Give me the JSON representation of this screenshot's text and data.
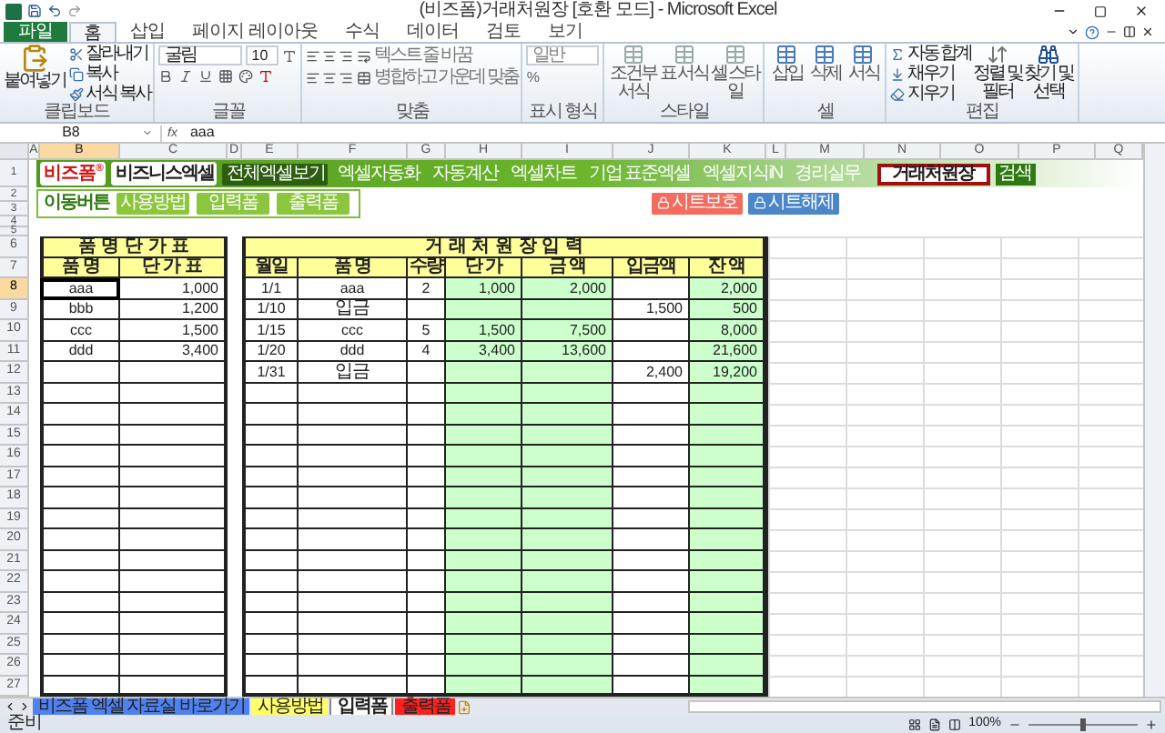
{
  "window": {
    "title": "(비즈폼)거래처원장 [호환 모드] - Microsoft Excel"
  },
  "ribbon_tabs": [
    {
      "label": "파일",
      "kind": "file",
      "selected": false
    },
    {
      "label": "홈",
      "kind": "tab",
      "selected": true
    },
    {
      "label": "삽입",
      "kind": "tab",
      "selected": false
    },
    {
      "label": "페이지 레이아웃",
      "kind": "tab",
      "selected": false
    },
    {
      "label": "수식",
      "kind": "tab",
      "selected": false
    },
    {
      "label": "데이터",
      "kind": "tab",
      "selected": false
    },
    {
      "label": "검토",
      "kind": "tab",
      "selected": false
    },
    {
      "label": "보기",
      "kind": "tab",
      "selected": false
    }
  ],
  "ribbon": {
    "groups": [
      {
        "kind": "clipboard",
        "label": "클립보드",
        "paste": "붙여넣기",
        "items": [
          "잘라내기",
          "복사",
          "서식 복사"
        ]
      },
      {
        "kind": "font",
        "label": "글꼴",
        "font": "굴림",
        "size": "10"
      },
      {
        "kind": "alignment",
        "label": "맞춤",
        "items": [
          "텍스트 줄 바꿈",
          "병합하고 가운데 맞춤"
        ]
      },
      {
        "kind": "number",
        "label": "표시 형식",
        "format": "일반",
        "symbol": "%"
      },
      {
        "kind": "styles",
        "label": "스타일",
        "items": [
          "조건부 서식",
          "표 서식",
          "셀 스타일"
        ]
      },
      {
        "kind": "cells",
        "label": "셀",
        "items": [
          "삽입",
          "삭제",
          "서식"
        ]
      },
      {
        "kind": "editing",
        "label": "편집",
        "items": [
          "자동 합계",
          "채우기",
          "지우기"
        ],
        "big": [
          "정렬 및 필터",
          "찾기 및 선택"
        ]
      }
    ]
  },
  "formula_bar": {
    "name_box": "B8",
    "function_label": "fx",
    "value": "aaa"
  },
  "column_headers": [
    {
      "label": "A",
      "selected": false
    },
    {
      "label": "B",
      "selected": true
    },
    {
      "label": "C",
      "selected": false
    },
    {
      "label": "D",
      "selected": false
    },
    {
      "label": "E",
      "selected": false
    },
    {
      "label": "F",
      "selected": false
    },
    {
      "label": "G",
      "selected": false
    },
    {
      "label": "H",
      "selected": false
    },
    {
      "label": "I",
      "selected": false
    },
    {
      "label": "J",
      "selected": false
    },
    {
      "label": "K",
      "selected": false
    },
    {
      "label": "L",
      "selected": false
    },
    {
      "label": "M",
      "selected": false
    },
    {
      "label": "N",
      "selected": false
    },
    {
      "label": "O",
      "selected": false
    },
    {
      "label": "P",
      "selected": false
    },
    {
      "label": "Q",
      "selected": false
    }
  ],
  "row_headers": [
    {
      "label": "1",
      "selected": false
    },
    {
      "label": "2",
      "selected": false
    },
    {
      "label": "3",
      "selected": false
    },
    {
      "label": "4",
      "selected": false
    },
    {
      "label": "5",
      "selected": false
    },
    {
      "label": "6",
      "selected": false
    },
    {
      "label": "7",
      "selected": false
    },
    {
      "label": "8",
      "selected": true
    },
    {
      "label": "9",
      "selected": false
    },
    {
      "label": "10",
      "selected": false
    },
    {
      "label": "11",
      "selected": false
    },
    {
      "label": "12",
      "selected": false
    },
    {
      "label": "13",
      "selected": false
    },
    {
      "label": "14",
      "selected": false
    },
    {
      "label": "15",
      "selected": false
    },
    {
      "label": "16",
      "selected": false
    },
    {
      "label": "17",
      "selected": false
    },
    {
      "label": "18",
      "selected": false
    },
    {
      "label": "19",
      "selected": false
    },
    {
      "label": "20",
      "selected": false
    },
    {
      "label": "21",
      "selected": false
    },
    {
      "label": "22",
      "selected": false
    },
    {
      "label": "23",
      "selected": false
    },
    {
      "label": "24",
      "selected": false
    },
    {
      "label": "25",
      "selected": false
    },
    {
      "label": "26",
      "selected": false
    },
    {
      "label": "27",
      "selected": false
    }
  ],
  "banner": {
    "logo": "비즈폼",
    "logo_mark": "®",
    "brand": "비즈니스엑셀",
    "nav": [
      {
        "label": "전체엑셀보기",
        "selected": true
      },
      {
        "label": "엑셀자동화",
        "selected": false
      },
      {
        "label": "자동계산",
        "selected": false
      },
      {
        "label": "엑셀차트",
        "selected": false
      },
      {
        "label": "기업 표준엑셀",
        "selected": false
      },
      {
        "label": "엑셀지식iN",
        "selected": false
      },
      {
        "label": "경리실무",
        "selected": false
      }
    ],
    "search_value": "거래처원장",
    "search_button": "검색"
  },
  "move_buttons": {
    "label": "이동버튼",
    "buttons": [
      "사용방법",
      "입력폼",
      "출력폼"
    ]
  },
  "protect_buttons": [
    {
      "label": "시트보호",
      "color": "#f26c5f"
    },
    {
      "label": "시트해제",
      "color": "#4a86c8"
    }
  ],
  "price_table": {
    "title": "품 명 단 가 표",
    "headers": [
      "품 명",
      "단 가 표"
    ],
    "rows": [
      {
        "item": "aaa",
        "price": "1,000",
        "selected": true
      },
      {
        "item": "bbb",
        "price": "1,200",
        "selected": false
      },
      {
        "item": "ccc",
        "price": "1,500",
        "selected": false
      },
      {
        "item": "ddd",
        "price": "3,400",
        "selected": false
      }
    ]
  },
  "ledger": {
    "title": "거 래 처 원 장 입 력",
    "headers": [
      "월일",
      "품 명",
      "수량",
      "단 가",
      "금 액",
      "입금액",
      "잔 액"
    ],
    "rows": [
      {
        "date": "1/1",
        "item": "aaa",
        "qty": "2",
        "unit_price": "1,000",
        "amount": "2,000",
        "balance": "2,000"
      },
      {
        "date": "1/10",
        "item": "입금",
        "deposit": "1,500",
        "balance": "500"
      },
      {
        "date": "1/15",
        "item": "ccc",
        "qty": "5",
        "unit_price": "1,500",
        "amount": "7,500",
        "balance": "8,000"
      },
      {
        "date": "1/20",
        "item": "ddd",
        "qty": "4",
        "unit_price": "3,400",
        "amount": "13,600",
        "balance": "21,600"
      },
      {
        "date": "1/31",
        "item": "입금",
        "deposit": "2,400",
        "balance": "19,200"
      }
    ]
  },
  "sheet_tabs": [
    {
      "label": "비즈폼 엑셀 자료실 바로가기",
      "color": "#4f81f0",
      "selected": false
    },
    {
      "label": "사용방법",
      "color": "#ffff66",
      "selected": false
    },
    {
      "label": "입력폼",
      "color": "#ffffff",
      "selected": true
    },
    {
      "label": "출력폼",
      "color": "#ff2020",
      "selected": false
    }
  ],
  "status_bar": {
    "text": "준비",
    "zoom": "100%",
    "level": 0.5
  }
}
